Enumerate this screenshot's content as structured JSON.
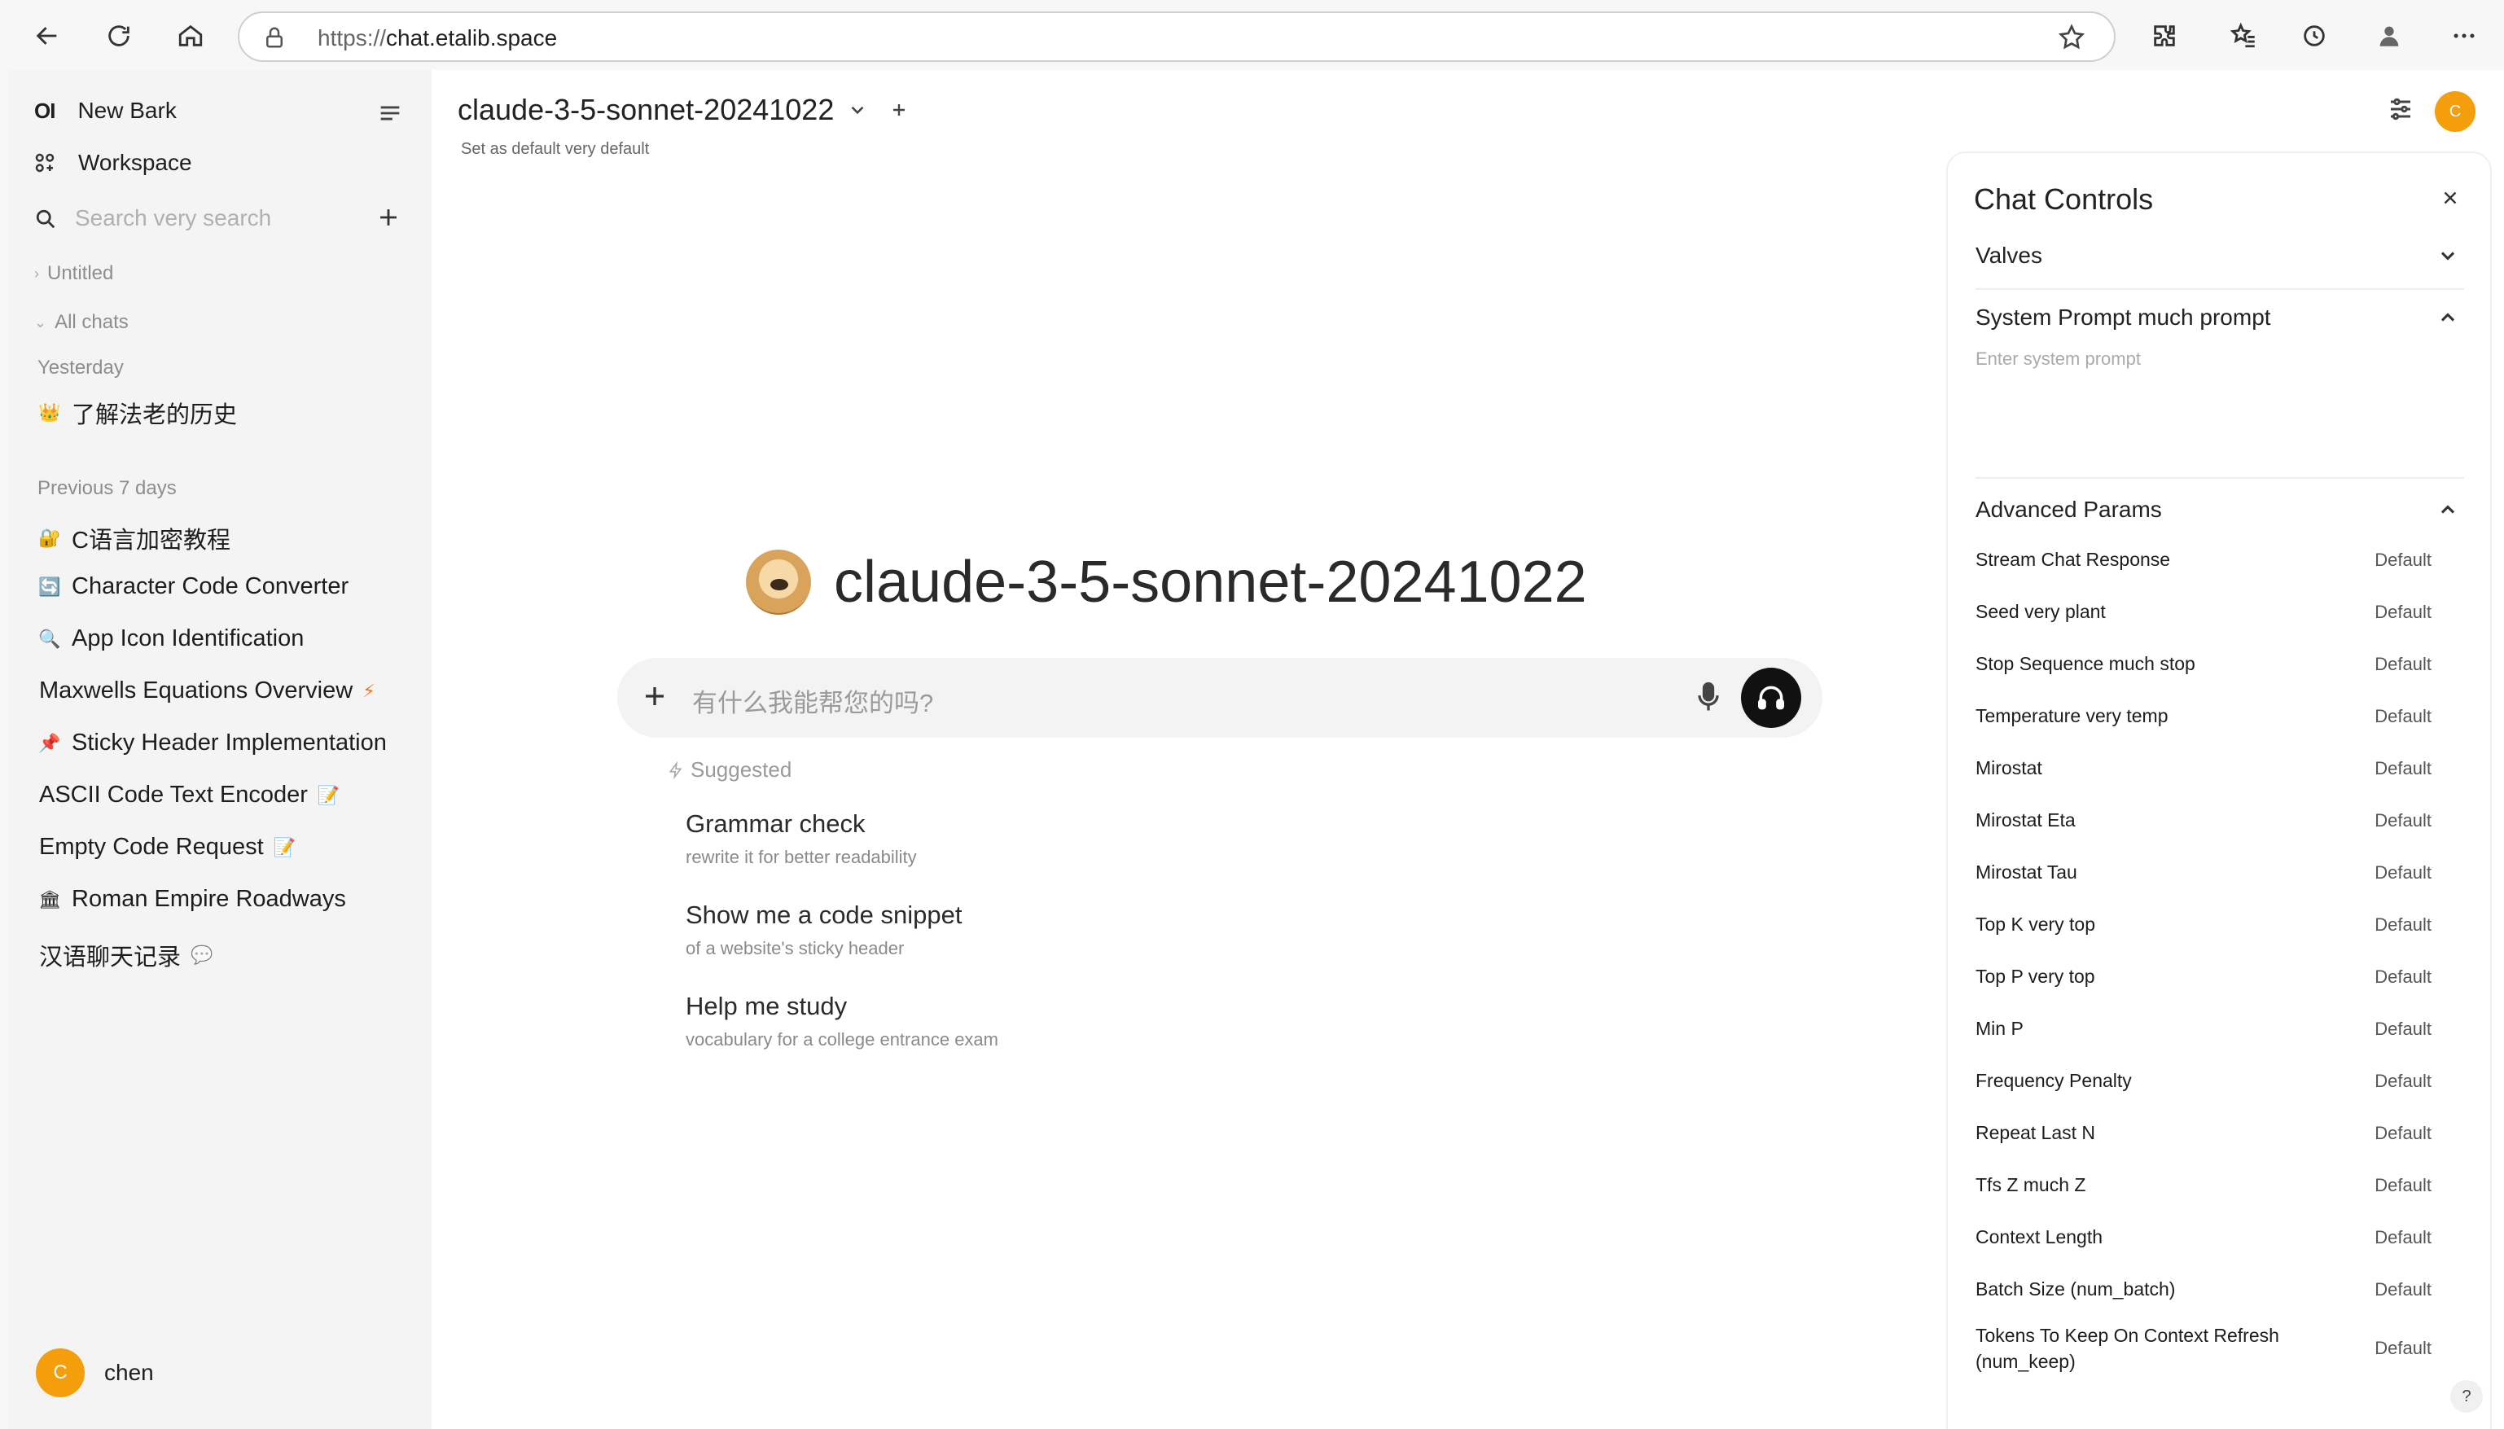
{
  "browser": {
    "url_scheme": "https://",
    "url_host": "chat.etalib.space"
  },
  "sidebar": {
    "brand_logo": "OI",
    "brand_name": "New Bark",
    "workspace": "Workspace",
    "search_placeholder": "Search very search",
    "folders": [
      {
        "label": "Untitled"
      },
      {
        "label": "All chats"
      }
    ],
    "groups": [
      {
        "label": "Yesterday"
      },
      {
        "label": "Previous 7 days"
      }
    ],
    "chats": [
      {
        "emoji": "👑",
        "label": "了解法老的历史",
        "tail": ""
      },
      {
        "emoji": "🔐",
        "label": "C语言加密教程",
        "tail": ""
      },
      {
        "emoji": "🔄",
        "label": "Character Code Converter",
        "tail": ""
      },
      {
        "emoji": "🔍",
        "label": "App Icon Identification",
        "tail": ""
      },
      {
        "emoji": "",
        "label": "Maxwells Equations Overview",
        "tail": "⚡"
      },
      {
        "emoji": "📌",
        "label": "Sticky Header Implementation",
        "tail": ""
      },
      {
        "emoji": "",
        "label": "ASCII Code Text Encoder",
        "tail": "📝"
      },
      {
        "emoji": "",
        "label": "Empty Code Request",
        "tail": "📝"
      },
      {
        "emoji": "🏛",
        "label": "Roman Empire Roadways",
        "tail": ""
      },
      {
        "emoji": "",
        "label": "汉语聊天记录",
        "tail": "💬"
      }
    ],
    "user": {
      "initial": "C",
      "name": "chen"
    }
  },
  "main": {
    "model_name": "claude-3-5-sonnet-20241022",
    "set_default": "Set as default very default",
    "hero_title": "claude-3-5-sonnet-20241022",
    "input_placeholder": "有什么我能帮您的吗?",
    "suggested_label": "Suggested",
    "suggestions": [
      {
        "title": "Grammar check",
        "sub": "rewrite it for better readability"
      },
      {
        "title": "Show me a code snippet",
        "sub": "of a website's sticky header"
      },
      {
        "title": "Help me study",
        "sub": "vocabulary for a college entrance exam"
      }
    ],
    "top_avatar_initial": "C"
  },
  "controls": {
    "title": "Chat Controls",
    "valves": "Valves",
    "system_prompt": "System Prompt much prompt",
    "system_prompt_placeholder": "Enter system prompt",
    "advanced_params": "Advanced Params",
    "params": [
      {
        "name": "Stream Chat Response",
        "value": "Default"
      },
      {
        "name": "Seed very plant",
        "value": "Default"
      },
      {
        "name": "Stop Sequence much stop",
        "value": "Default"
      },
      {
        "name": "Temperature very temp",
        "value": "Default"
      },
      {
        "name": "Mirostat",
        "value": "Default"
      },
      {
        "name": "Mirostat Eta",
        "value": "Default"
      },
      {
        "name": "Mirostat Tau",
        "value": "Default"
      },
      {
        "name": "Top K very top",
        "value": "Default"
      },
      {
        "name": "Top P very top",
        "value": "Default"
      },
      {
        "name": "Min P",
        "value": "Default"
      },
      {
        "name": "Frequency Penalty",
        "value": "Default"
      },
      {
        "name": "Repeat Last N",
        "value": "Default"
      },
      {
        "name": "Tfs Z much Z",
        "value": "Default"
      },
      {
        "name": "Context Length",
        "value": "Default"
      },
      {
        "name": "Batch Size (num_batch)",
        "value": "Default"
      },
      {
        "name": "Tokens To Keep On Context Refresh (num_keep)",
        "value": "Default"
      }
    ],
    "help": "?"
  }
}
